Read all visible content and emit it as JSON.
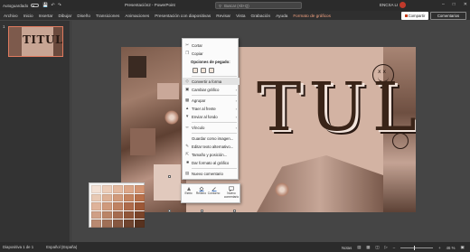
{
  "titlebar": {
    "autosave_label": "Autoguardado",
    "toggle_state": "off",
    "doc_title": "Presentación2 - PowerPoint",
    "search_placeholder": "Buscar (Alt+Q)",
    "user_name": "ENCXA LI"
  },
  "ribbon": {
    "tabs": [
      "Archivo",
      "Inicio",
      "Insertar",
      "Dibujar",
      "Diseño",
      "Transiciones",
      "Animaciones",
      "Presentación con diapositivas",
      "Revisar",
      "Vista",
      "Grabación",
      "Ayuda",
      "Formato de gráficos"
    ],
    "active_tab_index": 12,
    "share_label": "Compartir",
    "comments_label": "Comentarios"
  },
  "thumbnails": {
    "slide_number": "1",
    "slide_text": "TITULO"
  },
  "slide": {
    "title_text": "TULO"
  },
  "context_menu": {
    "items": {
      "cut": "Cortar",
      "copy": "Copiar",
      "paste_options": "Opciones de pegado:",
      "convert_shape": "Convertir a forma",
      "change_graphic": "Cambiar gráfico",
      "group": "Agrupar",
      "bring_front": "Traer al frente",
      "send_back": "Enviar al fondo",
      "link": "Vínculo",
      "save_image": "Guardar como imagen...",
      "alt_text": "Editar texto alternativo...",
      "size_position": "Tamaño y posición...",
      "format_graphic": "Dar formato al gráfico",
      "new_comment": "Nuevo comentario"
    }
  },
  "mini_toolbar": {
    "style": "Estilo",
    "fill": "Relleno",
    "outline": "Contorno",
    "new_comment": "Nuevo comentario"
  },
  "palette": {
    "colors": [
      "#f3e1d5",
      "#eccdb9",
      "#e4b99f",
      "#dca688",
      "#d39472",
      "#e8c9b4",
      "#ddb196",
      "#d19a7a",
      "#c58460",
      "#b8704a",
      "#dfb39a",
      "#cf9a7c",
      "#bf8262",
      "#ae6b4b",
      "#9c5837",
      "#cf9f86",
      "#ba8467",
      "#a56b4f",
      "#915639",
      "#7b4429",
      "#b98a72",
      "#9f6f56",
      "#865740",
      "#6e432e",
      "#57321f"
    ]
  },
  "statusbar": {
    "slide_info": "Diapositiva 1 de 1",
    "language": "Español (España)",
    "notes": "Notas",
    "zoom": "46 %"
  },
  "colors": {
    "accent": "#c43e1c",
    "active_tab": "#f0a080",
    "menu_bg": "#fbfbfb"
  }
}
